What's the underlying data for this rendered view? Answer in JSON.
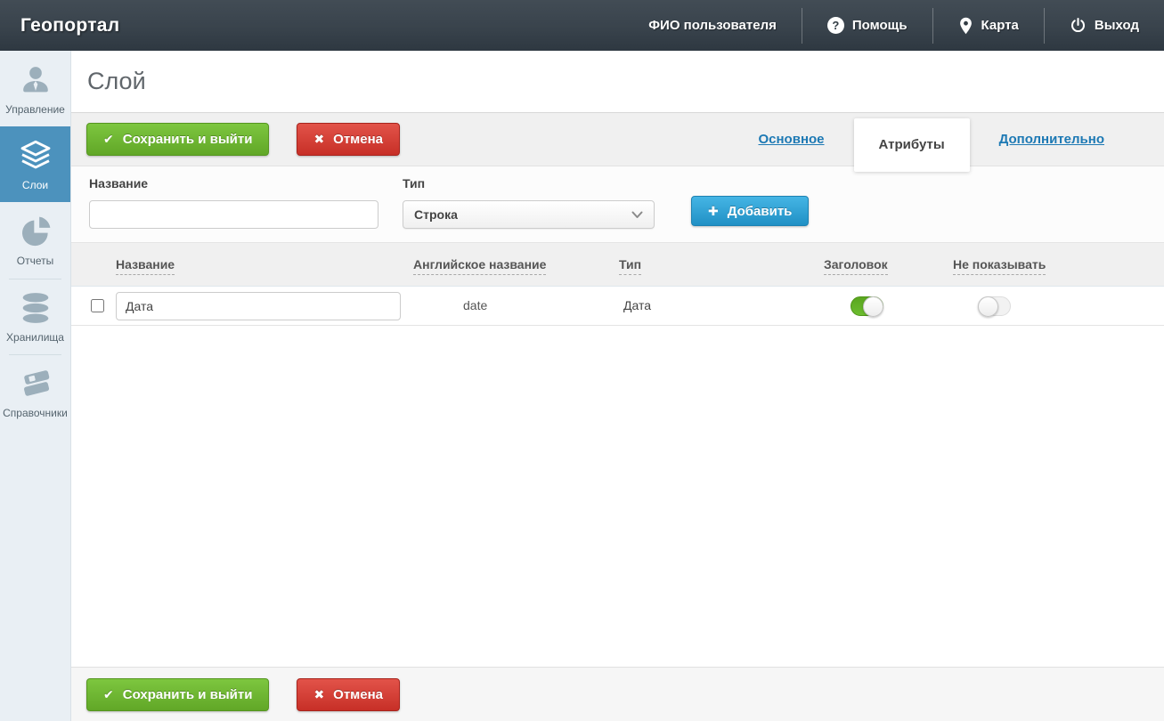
{
  "app": {
    "title": "Геопортал"
  },
  "topbar": {
    "user_name": "ФИО пользователя",
    "help_label": "Помощь",
    "map_label": "Карта",
    "logout_label": "Выход"
  },
  "icons": {
    "help": "?",
    "check": "✔",
    "cross": "✖",
    "plus": "✚"
  },
  "sidebar": {
    "items": [
      {
        "label": "Управление",
        "icon": "user-icon",
        "active": false
      },
      {
        "label": "Слои",
        "icon": "layers-icon",
        "active": true
      },
      {
        "label": "Отчеты",
        "icon": "pie-chart-icon",
        "active": false
      },
      {
        "label": "Хранилища",
        "icon": "database-icon",
        "active": false
      },
      {
        "label": "Справочники",
        "icon": "books-icon",
        "active": false
      }
    ]
  },
  "page": {
    "title": "Слой"
  },
  "toolbar": {
    "save_label": "Сохранить и выйти",
    "cancel_label": "Отмена"
  },
  "tabs": [
    {
      "label": "Основное",
      "active": false
    },
    {
      "label": "Атрибуты",
      "active": true
    },
    {
      "label": "Дополнительно",
      "active": false
    }
  ],
  "form": {
    "name_label": "Название",
    "name_value": "",
    "type_label": "Тип",
    "type_value": "Строка",
    "add_label": "Добавить"
  },
  "table": {
    "columns": {
      "name": "Название",
      "english_name": "Английское название",
      "type": "Тип",
      "header": "Заголовок",
      "hide": "Не показывать"
    },
    "rows": [
      {
        "name": "Дата",
        "english_name": "date",
        "type": "Дата",
        "header_toggle": true,
        "hide_toggle": false,
        "selected": false
      }
    ]
  },
  "colors": {
    "topbar_bg": "#39434c",
    "sidebar_bg": "#e9eff4",
    "active_item": "#4c92bd",
    "save_green": "#6fb834",
    "cancel_red": "#d43b32",
    "add_blue": "#2e9fd2",
    "toggle_on_green": "#6cbd2f",
    "tab_link_blue": "#1d79b4"
  }
}
